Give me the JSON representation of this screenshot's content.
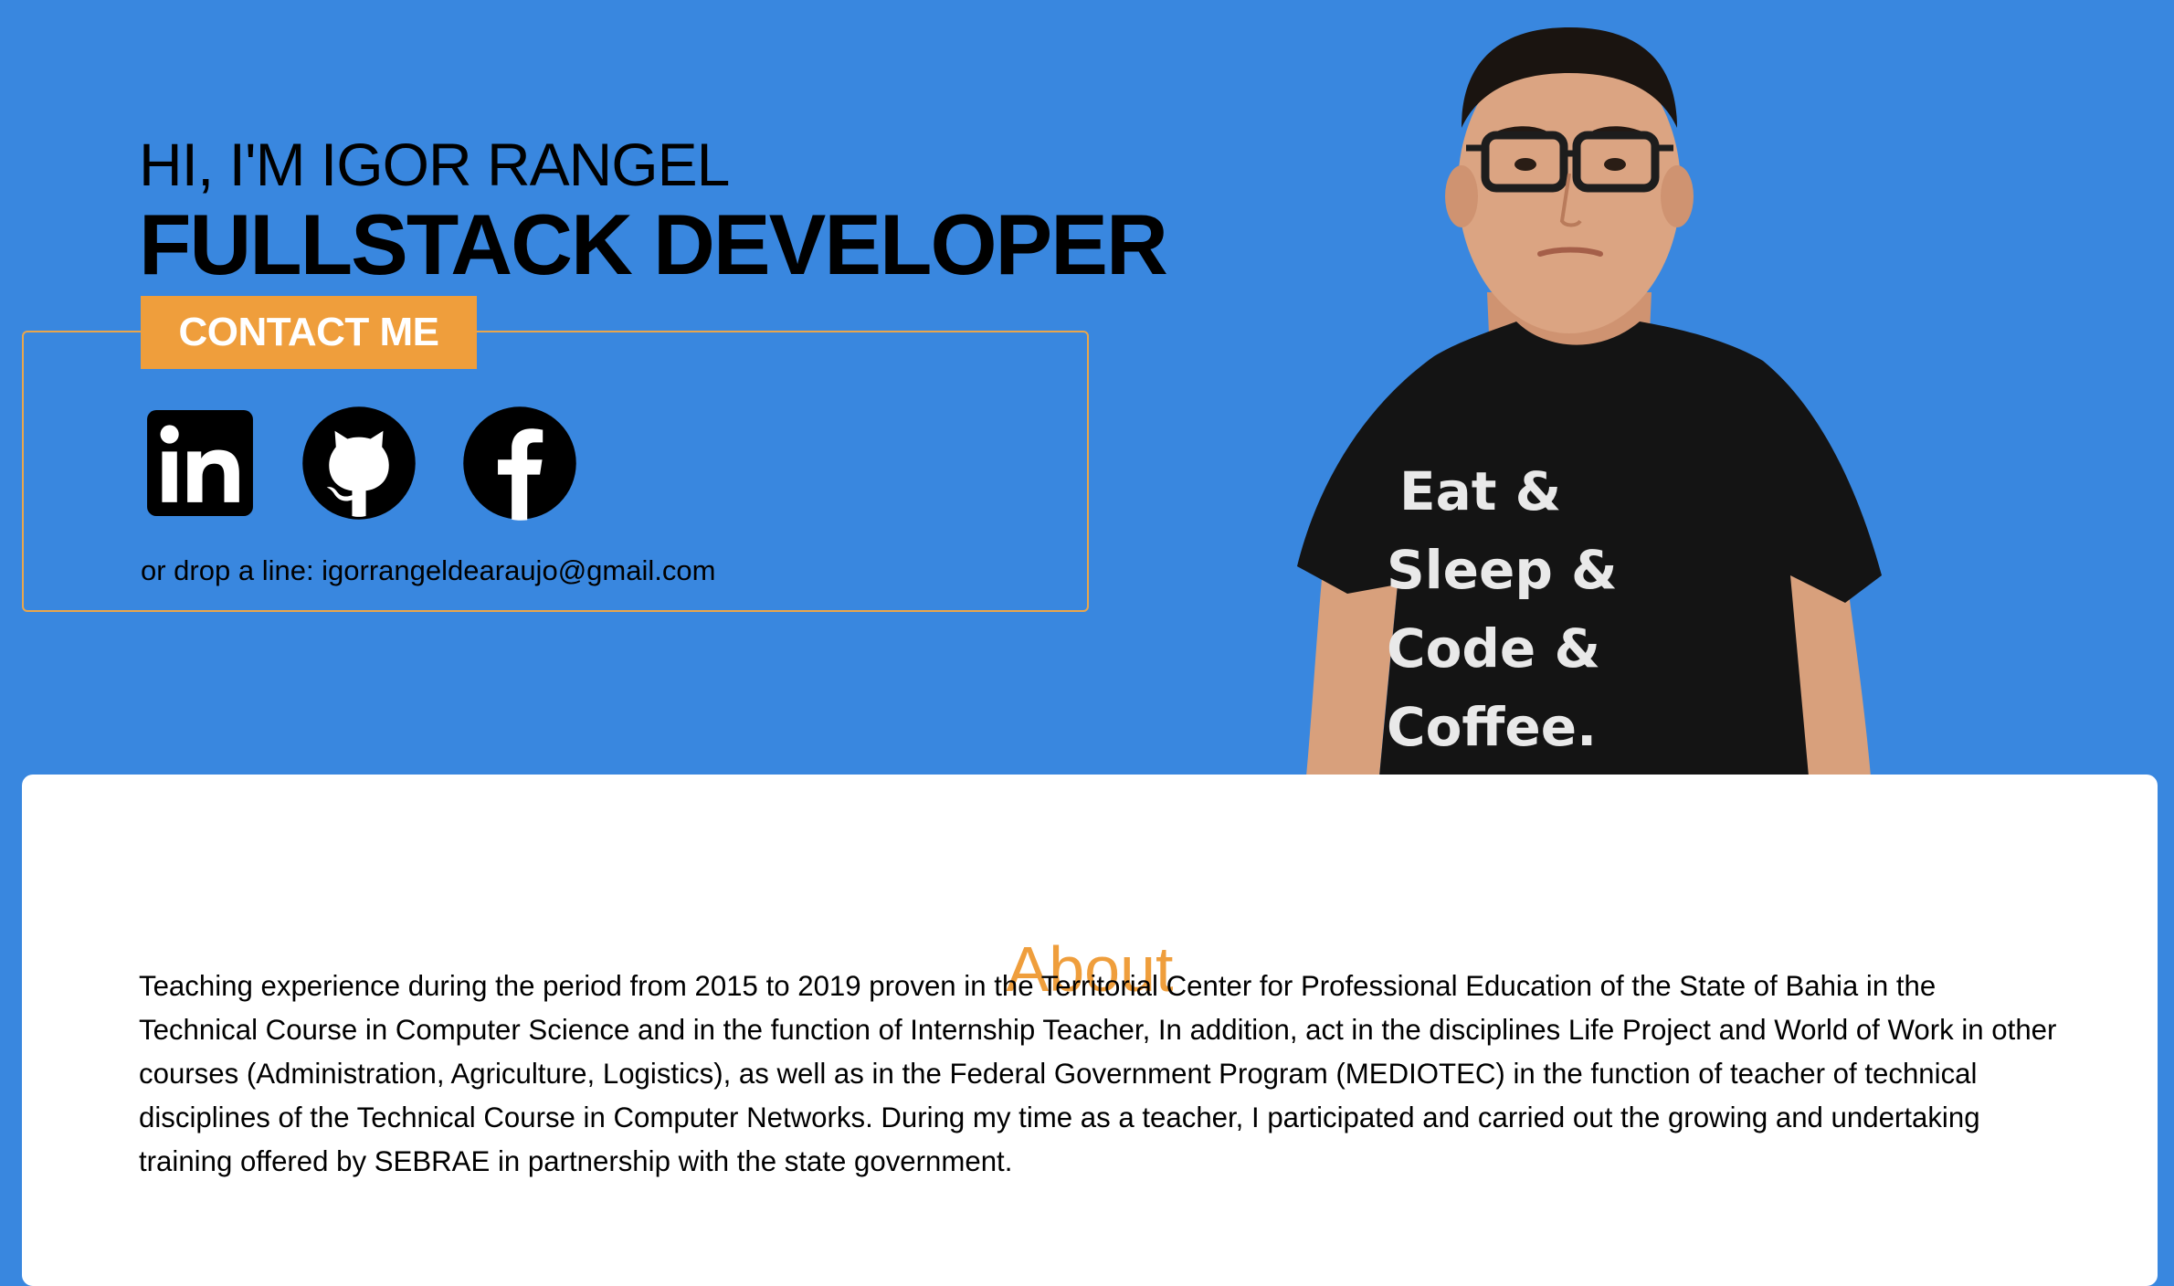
{
  "hero": {
    "greeting": "HI, I'M IGOR RANGEL",
    "role": "FULLSTACK DEVELOPER",
    "contact_button": "CONTACT ME",
    "drop_line": "or drop a line: igorrangeldearaujo@gmail.com"
  },
  "social": {
    "icons": [
      "linkedin-icon",
      "github-icon",
      "facebook-icon"
    ]
  },
  "portrait": {
    "shirt_lines": [
      "Eat &",
      "Sleep &",
      "Code &",
      "Coffee."
    ]
  },
  "about": {
    "title": "About",
    "text": "Teaching experience during the period from 2015 to 2019 proven in the Territorial Center for Professional Education of the State of Bahia in the Technical Course in Computer Science and in the function of Internship Teacher, In addition, act in the disciplines Life Project and World of Work in other courses (Administration, Agriculture, Logistics), as well as in the Federal Government Program (MEDIOTEC) in the function of teacher of technical disciplines of the Technical Course in Computer Networks. During my time as a teacher, I participated and carried out the growing and undertaking training offered by SEBRAE in partnership with the state government."
  },
  "colors": {
    "background": "#3987df",
    "accent": "#ef9e3c",
    "card": "#ffffff",
    "text": "#000000"
  }
}
